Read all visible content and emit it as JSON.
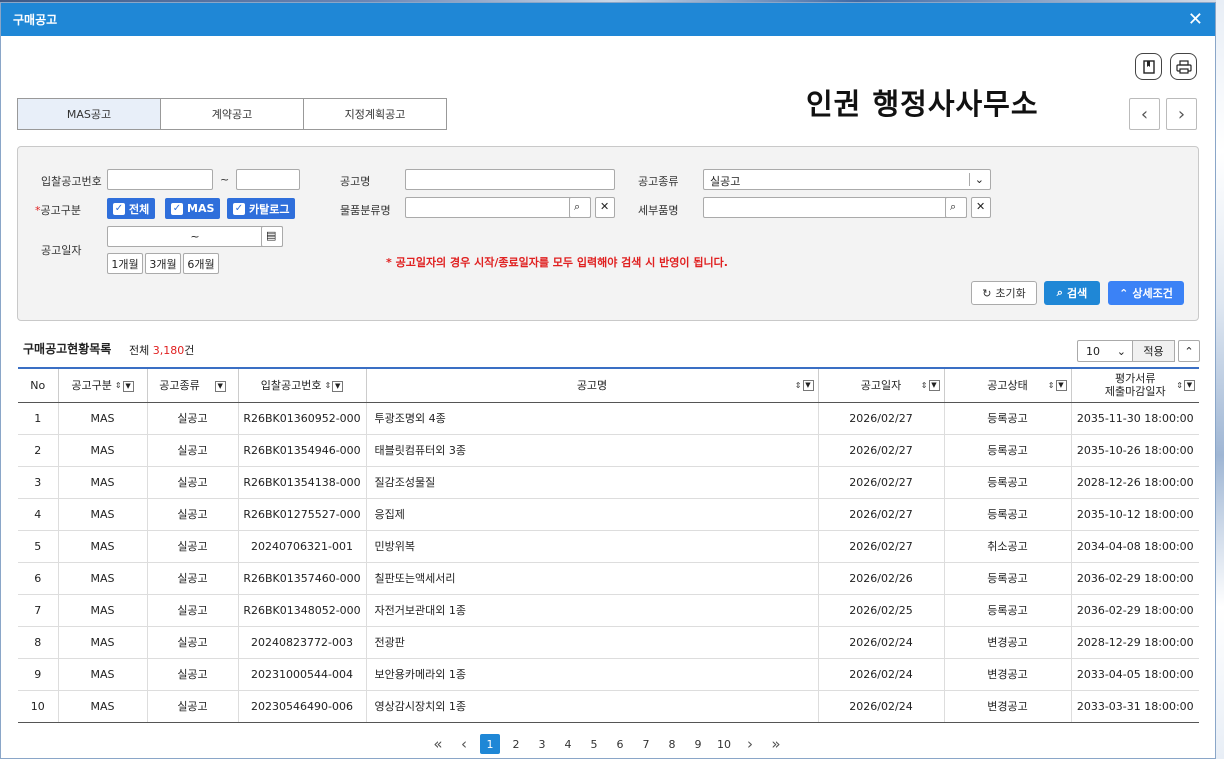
{
  "window": {
    "title": "구매공고",
    "close_icon": "close-icon"
  },
  "header": {
    "company": "인권 행정사사무소"
  },
  "tabs": [
    "MAS공고",
    "계약공고",
    "지정계획공고"
  ],
  "search": {
    "bid_no_label": "입찰공고번호",
    "tilde": "~",
    "notice_name_label": "공고명",
    "notice_type_label": "공고종류",
    "notice_type_value": "실공고",
    "category_label": "공고구분",
    "category_req": "*",
    "checks": [
      "전체",
      "MAS",
      "카탈로그"
    ],
    "item_class_label": "물품분류명",
    "detail_item_label": "세부품명",
    "date_label": "공고일자",
    "date_tilde": "~",
    "months": [
      "1개월",
      "3개월",
      "6개월"
    ],
    "notice": "* 공고일자의 경우 시작/종료일자를 모두 입력해야 검색 시 반영이 됩니다.",
    "reset_label": "초기화",
    "search_label": "검색",
    "detail_label": "상세조건"
  },
  "list": {
    "title": "구매공고현황목록",
    "total_prefix": "전체 ",
    "total_num": "3,180",
    "total_suffix": "건",
    "page_size": "10",
    "apply_label": "적용"
  },
  "table": {
    "headers": [
      "No",
      "공고구분",
      "공고종류",
      "입찰공고번호",
      "공고명",
      "공고일자",
      "공고상태",
      "평가서류",
      "제출마감일자"
    ],
    "rows": [
      [
        "1",
        "MAS",
        "실공고",
        "R26BK01360952-000",
        "투광조명외 4종",
        "2026/02/27",
        "등록공고",
        "2035-11-30 18:00:00"
      ],
      [
        "2",
        "MAS",
        "실공고",
        "R26BK01354946-000",
        "태블릿컴퓨터외 3종",
        "2026/02/27",
        "등록공고",
        "2035-10-26 18:00:00"
      ],
      [
        "3",
        "MAS",
        "실공고",
        "R26BK01354138-000",
        "질감조성물질",
        "2026/02/27",
        "등록공고",
        "2028-12-26 18:00:00"
      ],
      [
        "4",
        "MAS",
        "실공고",
        "R26BK01275527-000",
        "응집제",
        "2026/02/27",
        "등록공고",
        "2035-10-12 18:00:00"
      ],
      [
        "5",
        "MAS",
        "실공고",
        "20240706321-001",
        "민방위복",
        "2026/02/27",
        "취소공고",
        "2034-04-08 18:00:00"
      ],
      [
        "6",
        "MAS",
        "실공고",
        "R26BK01357460-000",
        "칠판또는액세서리",
        "2026/02/26",
        "등록공고",
        "2036-02-29 18:00:00"
      ],
      [
        "7",
        "MAS",
        "실공고",
        "R26BK01348052-000",
        "자전거보관대외 1종",
        "2026/02/25",
        "등록공고",
        "2036-02-29 18:00:00"
      ],
      [
        "8",
        "MAS",
        "실공고",
        "20240823772-003",
        "전광판",
        "2026/02/24",
        "변경공고",
        "2028-12-29 18:00:00"
      ],
      [
        "9",
        "MAS",
        "실공고",
        "20231000544-004",
        "보안용카메라외 1종",
        "2026/02/24",
        "변경공고",
        "2033-04-05 18:00:00"
      ],
      [
        "10",
        "MAS",
        "실공고",
        "20230546490-006",
        "영상감시장치외 1종",
        "2026/02/24",
        "변경공고",
        "2033-03-31 18:00:00"
      ]
    ]
  },
  "pager": {
    "pages": [
      "1",
      "2",
      "3",
      "4",
      "5",
      "6",
      "7",
      "8",
      "9",
      "10"
    ],
    "current": "1"
  },
  "colors": {
    "titlebar": "#1f87d6",
    "checkbox": "#2f6fdb",
    "notice": "#e02020"
  }
}
